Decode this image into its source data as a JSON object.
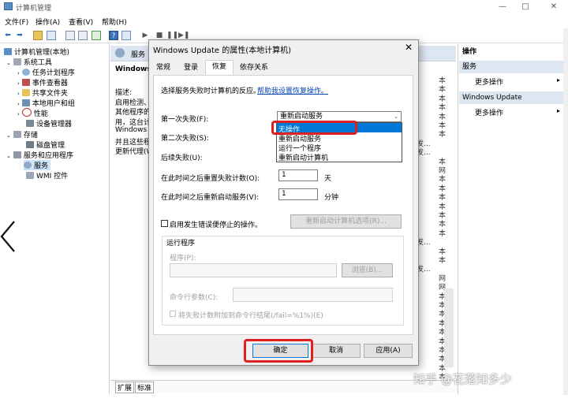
{
  "window": {
    "title": "计算机管理",
    "minimize": "—",
    "maximize": "□",
    "close": "✕"
  },
  "menu": [
    "文件(F)",
    "操作(A)",
    "查看(V)",
    "帮助(H)"
  ],
  "tree": {
    "root": "计算机管理(本地)",
    "system_tools": "系统工具",
    "task_scheduler": "任务计划程序",
    "event_viewer": "事件查看器",
    "shared_folders": "共享文件夹",
    "local_users": "本地用户和组",
    "performance": "性能",
    "device_manager": "设备管理器",
    "storage": "存储",
    "disk_management": "磁盘管理",
    "services_apps": "服务和应用程序",
    "services": "服务",
    "wmi": "WMI 控件"
  },
  "middle": {
    "header_label": "服务",
    "service_name": "Windows",
    "desc_lines": [
      "描述:",
      "启用检测、",
      "其他程序的",
      "用，这台计",
      "Windows",
      "并且这些程",
      "更新代理(W"
    ],
    "col_right_values": [
      "本",
      "本",
      "本",
      "本",
      "本",
      "本",
      "本",
      "发...",
      "发...",
      "本",
      "网",
      "本",
      "本",
      "本",
      "本",
      "本",
      "本",
      "本",
      "发...",
      "本",
      "本",
      "发...",
      "网",
      "网",
      "本",
      "本",
      "本",
      "本",
      "本",
      "本",
      "本",
      "本",
      "本",
      "本"
    ],
    "col_left_values": [
      "发...",
      "发...",
      "发...",
      "发...",
      "发...",
      "发..."
    ],
    "tab_extended": "扩展",
    "tab_standard": "标准"
  },
  "actions": {
    "header": "操作",
    "section1": "服务",
    "section1_item": "更多操作",
    "section2": "Windows Update",
    "section2_item": "更多操作"
  },
  "dialog": {
    "title": "Windows Update 的属性(本地计算机)",
    "close": "✕",
    "tabs": [
      "常规",
      "登录",
      "恢复",
      "依存关系"
    ],
    "intro": "选择服务失败时计算机的反应。",
    "help_link": "帮助我设置恢复操作。",
    "first_failure_label": "第一次失败(F):",
    "first_failure_value": "重新启动服务",
    "second_failure_label": "第二次失败(S):",
    "subsequent_label": "后续失败(U):",
    "dropdown_options": [
      "无操作",
      "重新启动服务",
      "运行一个程序",
      "重新启动计算机"
    ],
    "reset_count_label": "在此时间之后重置失败计数(O):",
    "reset_count_value": "1",
    "reset_count_unit": "天",
    "restart_after_label": "在此时间之后重新启动服务(V):",
    "restart_after_value": "1",
    "restart_after_unit": "分钟",
    "enable_stop_error": "启用发生错误便停止的操作。",
    "restart_options_btn": "重新启动计算机选项(R)...",
    "run_program_group": "运行程序",
    "program_label": "程序(P):",
    "browse_btn": "浏览(B)...",
    "cmd_params_label": "命令行参数(C):",
    "append_fail_count": "将失败计数附加到命令行结尾(/fail=%1%)(E)",
    "ok": "确定",
    "cancel": "取消",
    "apply": "应用(A)"
  },
  "watermark": "知乎 @花落知多少",
  "colors": {
    "accent_blue": "#0078d7",
    "highlight_red": "#e02020",
    "header_blue": "#dde6f1",
    "link_blue": "#0645ad"
  }
}
